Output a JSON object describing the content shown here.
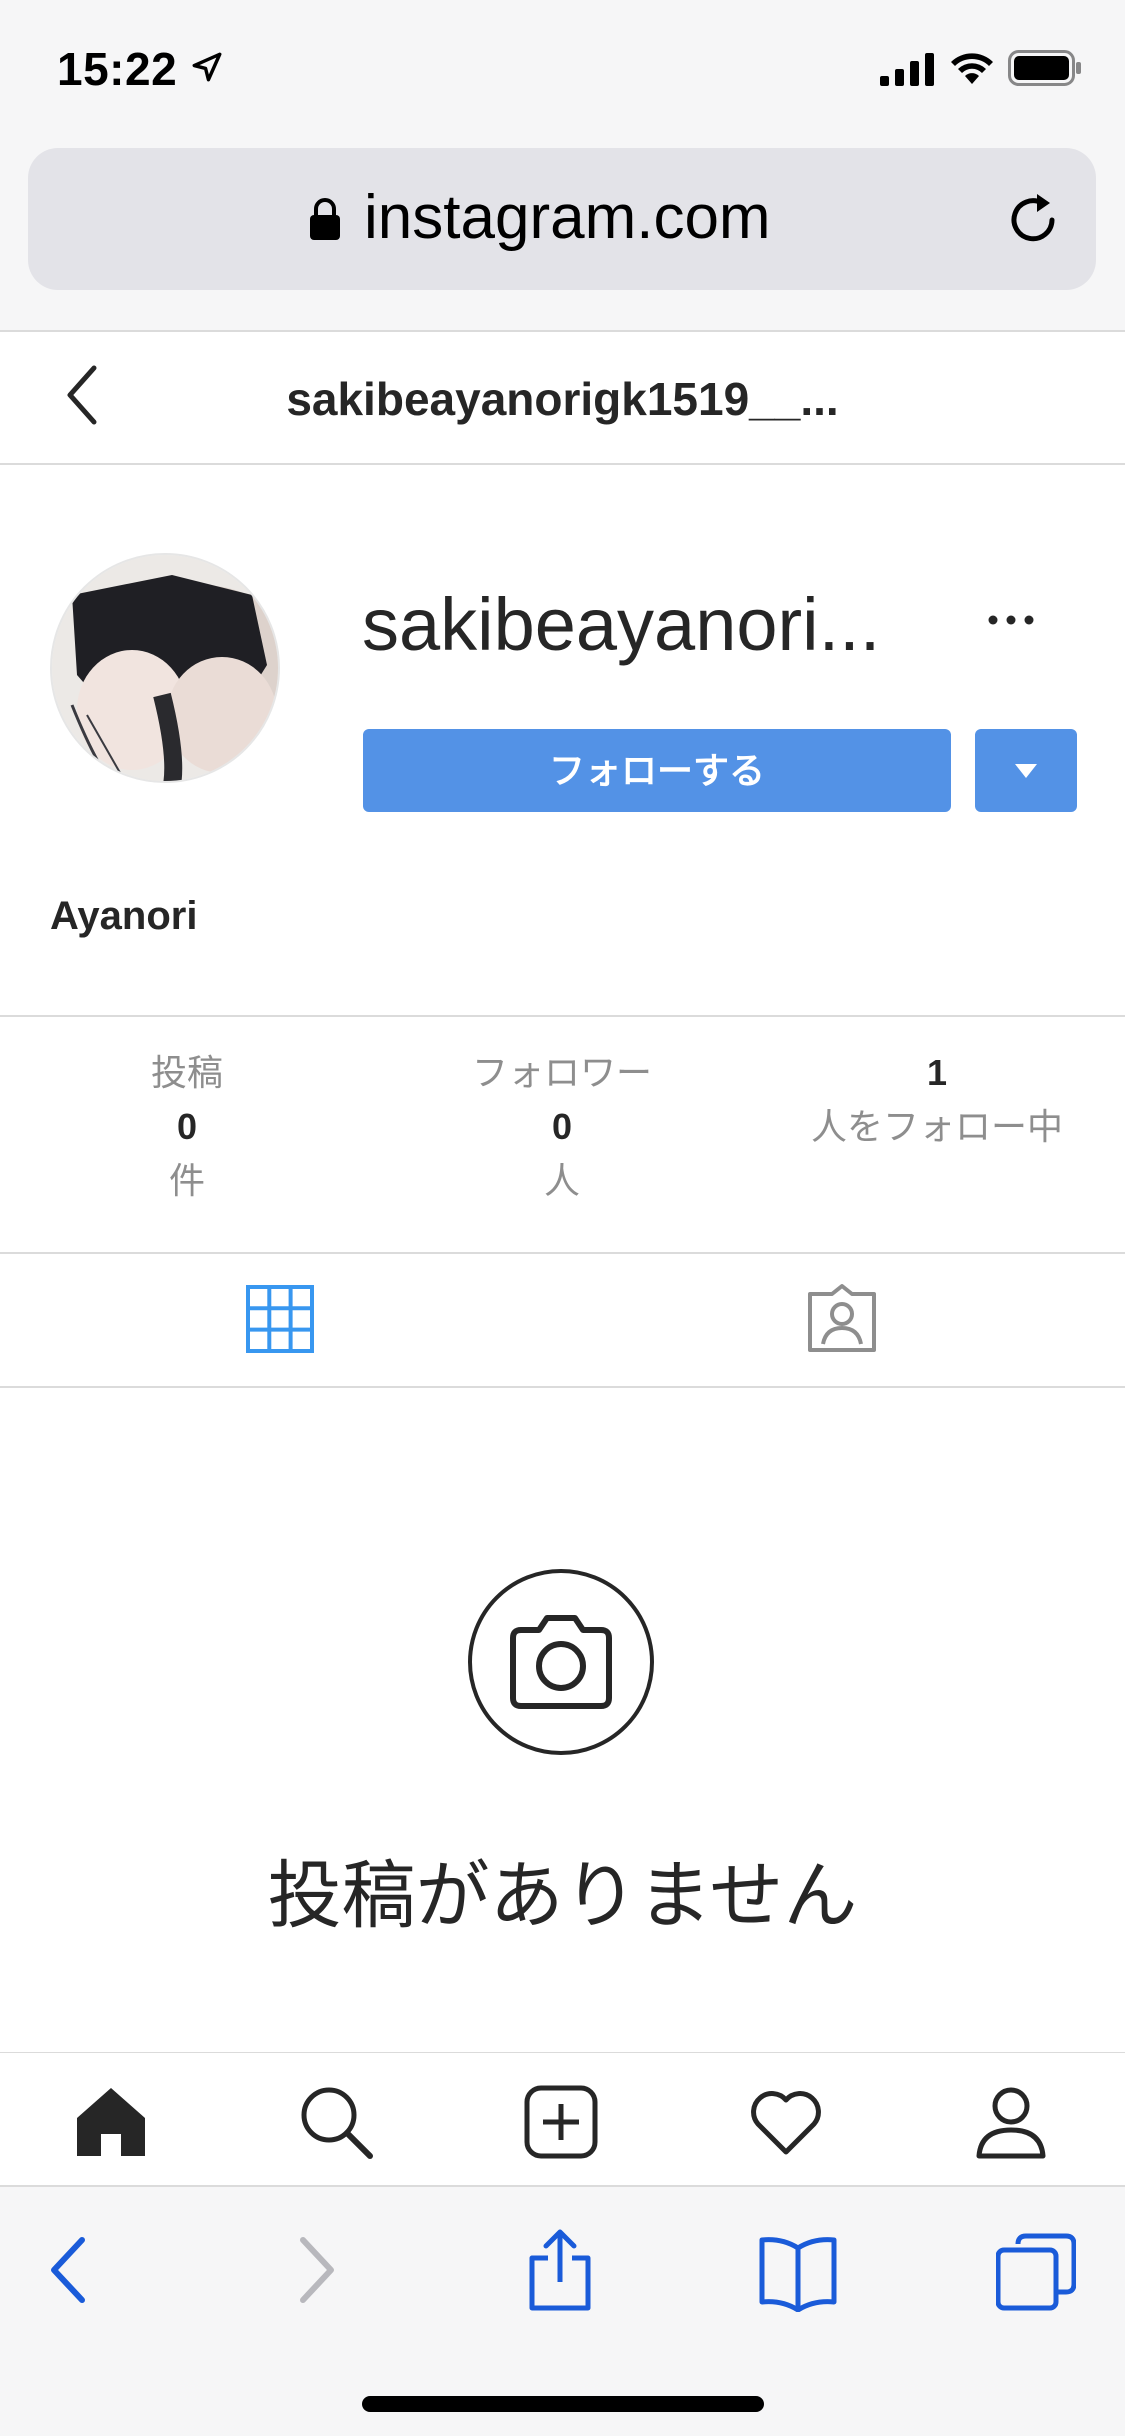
{
  "status_bar": {
    "time": "15:22"
  },
  "browser": {
    "url": "instagram.com",
    "icons": [
      "lock-icon",
      "reload-icon",
      "back-icon",
      "forward-icon",
      "share-icon",
      "bookmarks-icon",
      "tabs-icon"
    ]
  },
  "header": {
    "title": "sakibeayanorigk1519__..."
  },
  "profile": {
    "username": "sakibeayanori...",
    "full_name": "Ayanori",
    "follow_label": "フォローする"
  },
  "stats": {
    "posts": {
      "label": "投稿",
      "value": "0",
      "unit": "件"
    },
    "followers": {
      "label": "フォロワー",
      "value": "0",
      "unit": "人"
    },
    "following": {
      "value": "1",
      "label": "人をフォロー中"
    }
  },
  "empty_state": {
    "text": "投稿がありません"
  },
  "ig_nav": {
    "items": [
      "home-icon",
      "search-icon",
      "new-post-icon",
      "activity-heart-icon",
      "profile-icon"
    ]
  },
  "colors": {
    "accent": "#5392e6",
    "safari_blue": "#1a5bd9",
    "muted": "#8e8e8e",
    "text": "#262626"
  }
}
